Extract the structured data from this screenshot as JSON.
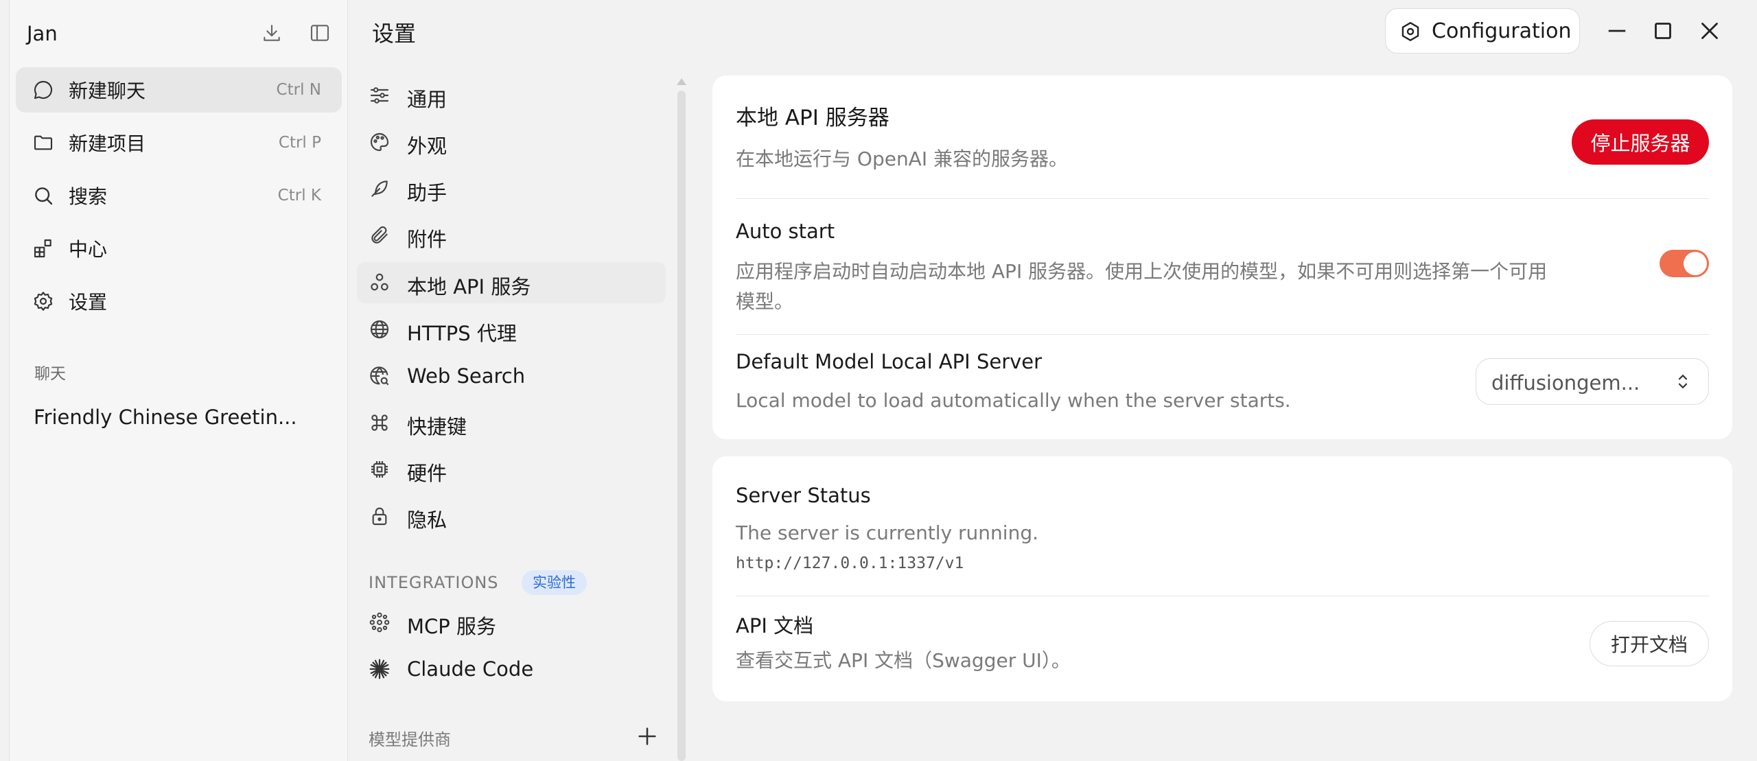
{
  "app": {
    "name": "Jan"
  },
  "sidebar": {
    "nav": [
      {
        "label": "新建聊天",
        "shortcut": "Ctrl  N",
        "icon": "chat-bubble-icon"
      },
      {
        "label": "新建项目",
        "shortcut": "Ctrl  P",
        "icon": "folder-icon"
      },
      {
        "label": "搜索",
        "shortcut": "Ctrl  K",
        "icon": "search-icon"
      },
      {
        "label": "中心",
        "icon": "grid-hub-icon"
      },
      {
        "label": "设置",
        "icon": "gear-icon"
      }
    ],
    "section_title": "聊天",
    "chats": [
      "Friendly Chinese Greetin..."
    ]
  },
  "settings": {
    "title": "设置",
    "menu": [
      {
        "label": "通用",
        "icon": "sliders-icon"
      },
      {
        "label": "外观",
        "icon": "palette-icon"
      },
      {
        "label": "助手",
        "icon": "feather-icon"
      },
      {
        "label": "附件",
        "icon": "paperclip-icon"
      },
      {
        "label": "本地 API 服务",
        "icon": "nodes-icon"
      },
      {
        "label": "HTTPS 代理",
        "icon": "globe-icon"
      },
      {
        "label": "Web Search",
        "icon": "globe-search-icon"
      },
      {
        "label": "快捷键",
        "icon": "command-key-icon"
      },
      {
        "label": "硬件",
        "icon": "chip-icon"
      },
      {
        "label": "隐私",
        "icon": "lock-icon"
      }
    ],
    "integrations_heading": "INTEGRATIONS",
    "integrations_badge": "实验性",
    "integrations": [
      {
        "label": "MCP 服务",
        "icon": "mcp-icon"
      },
      {
        "label": "Claude Code",
        "icon": "claude-star-icon"
      }
    ],
    "providers_heading": "模型提供商"
  },
  "header": {
    "config_button": "Configuration"
  },
  "local_api": {
    "title": "本地 API 服务器",
    "description": "在本地运行与 OpenAI 兼容的服务器。",
    "stop_button": "停止服务器",
    "auto_start": {
      "title": "Auto start",
      "description_line1": "应用程序启动时自动启动本地 API 服务器。使用上次使用的模型，如果不可用则选择第一个可用",
      "description_line2": "模型。",
      "enabled": true
    },
    "default_model": {
      "title": "Default Model Local API Server",
      "description": "Local model to load automatically when the server starts.",
      "selected": "diffusiongem..."
    }
  },
  "server_status": {
    "title": "Server Status",
    "description": "The server is currently running.",
    "url": "http://127.0.0.1:1337/v1"
  },
  "api_docs": {
    "title": "API 文档",
    "description": "查看交互式 API 文档（Swagger UI）。",
    "open_button": "打开文档"
  },
  "colors": {
    "stop_button": "#e0071e",
    "toggle_on": "#ef6f4e",
    "badge_bg": "#dde9fb",
    "badge_text": "#2d6ad9"
  }
}
